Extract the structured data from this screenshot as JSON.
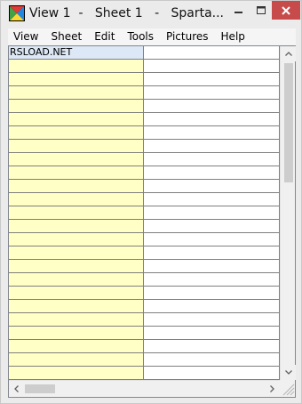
{
  "window": {
    "title": "View 1  -   Sheet 1   -   Sparta..."
  },
  "menubar": {
    "items": [
      "View",
      "Sheet",
      "Edit",
      "Tools",
      "Pictures",
      "Help"
    ]
  },
  "grid": {
    "cells": [
      [
        "RSLOAD.NET",
        ""
      ]
    ]
  },
  "icons": {
    "app": "spartan-app-icon",
    "minimize": "minimize-icon",
    "maximize": "maximize-icon",
    "close": "close-icon",
    "scroll_up": "arrow-up-icon",
    "scroll_down": "arrow-down-icon",
    "scroll_left": "arrow-left-icon",
    "scroll_right": "arrow-right-icon",
    "size_grip": "size-grip-icon"
  },
  "colors": {
    "first_column": "#ffffc6",
    "selected_cell": "#dce8f5",
    "close_button": "#c74b4b"
  }
}
